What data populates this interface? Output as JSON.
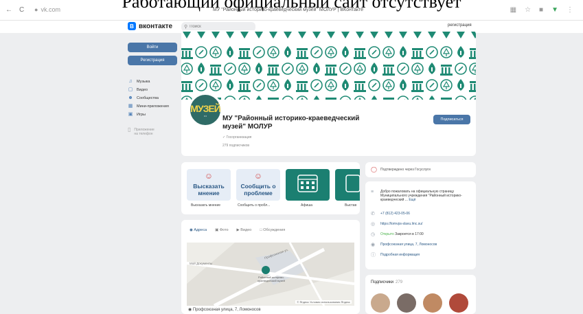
{
  "overlay": {
    "caption": "Работающий официальный сайт отсутствует"
  },
  "browser": {
    "back": "←",
    "refresh": "C",
    "url": "vk.com",
    "tab_title": "МУ \"Районный историко-краеведческий музей\" МОЛУР | ВКонтакте"
  },
  "header": {
    "logo_text": "вконтакте",
    "search_placeholder": "Поиск",
    "register": "регистрация"
  },
  "sidebar": {
    "login": "Войти",
    "register": "Регистрация",
    "items": [
      {
        "icon": "music-icon",
        "label": "Музыка"
      },
      {
        "icon": "video-icon",
        "label": "Видео"
      },
      {
        "icon": "communities-icon",
        "label": "Сообщества"
      },
      {
        "icon": "mini-apps-icon",
        "label": "Мини-приложения"
      },
      {
        "icon": "games-icon",
        "label": "Игры"
      }
    ],
    "apps_line1": "Приложение",
    "apps_line2": "на телефон"
  },
  "profile": {
    "avatar_text": "МУЗЕЙ",
    "name": "МУ \"Районный историко-краеведческий музей\" МОЛУР",
    "category": "Госорганизация",
    "subscribers": "279 подписчиков",
    "subscribe": "Подписаться"
  },
  "actions": [
    {
      "title": "Высказать мнение",
      "caption": "Высказать мнение",
      "bg": "#e6edf6"
    },
    {
      "title": "Сообщить о проблеме",
      "caption": "Сообщить о пробл...",
      "bg": "#e6edf6"
    },
    {
      "title": "",
      "caption": "Афиша",
      "bg": "#1b7f71"
    },
    {
      "title": "",
      "caption": "Выстав",
      "bg": "#1b7f71"
    }
  ],
  "map": {
    "tabs": [
      "Адреса",
      "Фото",
      "Видео",
      "Обсуждения"
    ],
    "address": "Профсоюзная улица, 7, Ломоносов",
    "label_street": "Профсоюзная ул.",
    "label_place": "Районный историко-краеведческий музей",
    "label_school": "Мой Документы",
    "footer": "© Яндекс Условия использования Яндекс"
  },
  "right": {
    "gosuslugi": "Подтверждено через Госуслуги",
    "welcome": "Добро пожаловать на официальную страницу Муниципального учреждения \"Районный историко-краеведческий ...",
    "more": "Ещё",
    "phone": "+7 (812) 423-05-06",
    "site": "https://lomvps-slavu.lmc.su/",
    "open": "Открыто",
    "closes": "Закроется в 17:00",
    "location": "Профсоюзная улица, 7, Ломоносов",
    "details": "Подробная информация",
    "subs_title": "Подписчики",
    "subs_count": "279"
  }
}
